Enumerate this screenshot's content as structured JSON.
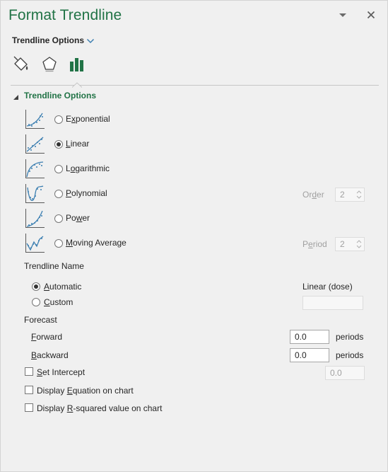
{
  "pane": {
    "title": "Format Trendline",
    "menu_icon": "dropdown-arrow-icon",
    "close_icon": "close-icon"
  },
  "options_menu": {
    "label": "Trendline Options"
  },
  "category_tabs": [
    {
      "name": "fill-line",
      "icon": "paint-bucket-icon"
    },
    {
      "name": "effects",
      "icon": "pentagon-icon"
    },
    {
      "name": "trendline-options",
      "icon": "bar-chart-icon",
      "selected": true
    }
  ],
  "section": {
    "title": "Trendline Options",
    "expanded": true
  },
  "types": [
    {
      "key": "exponential",
      "pre": "E",
      "mn": "x",
      "post": "ponential",
      "checked": false
    },
    {
      "key": "linear",
      "pre": "",
      "mn": "L",
      "post": "inear",
      "checked": true
    },
    {
      "key": "logarithmic",
      "pre": "L",
      "mn": "o",
      "post": "garithmic",
      "checked": false
    },
    {
      "key": "polynomial",
      "pre": "",
      "mn": "P",
      "post": "olynomial",
      "checked": false
    },
    {
      "key": "power",
      "pre": "Po",
      "mn": "w",
      "post": "er",
      "checked": false
    },
    {
      "key": "moving-average",
      "pre": "",
      "mn": "M",
      "post": "oving Average",
      "checked": false
    }
  ],
  "order": {
    "pre": "Or",
    "mn": "d",
    "post": "er",
    "value": "2"
  },
  "period": {
    "pre": "P",
    "mn": "e",
    "post": "riod",
    "value": "2"
  },
  "trendline_name": {
    "heading": "Trendline Name",
    "automatic": {
      "pre": "",
      "mn": "A",
      "post": "utomatic",
      "checked": true
    },
    "custom": {
      "pre": "",
      "mn": "C",
      "post": "ustom",
      "checked": false
    },
    "auto_value": "Linear (dose)",
    "custom_value": ""
  },
  "forecast": {
    "heading": "Forecast",
    "forward": {
      "pre": "",
      "mn": "F",
      "post": "orward",
      "value": "0.0",
      "unit": "periods"
    },
    "backward": {
      "pre": "",
      "mn": "B",
      "post": "ackward",
      "value": "0.0",
      "unit": "periods"
    }
  },
  "set_intercept": {
    "pre": "",
    "mn": "S",
    "post": "et Intercept",
    "checked": false,
    "value": "0.0"
  },
  "display_equation": {
    "pre": "Display ",
    "mn": "E",
    "post": "quation on chart",
    "checked": false
  },
  "display_rsquared": {
    "pre": "Display ",
    "mn": "R",
    "post": "-squared value on chart",
    "checked": false
  },
  "colors": {
    "accent": "#217346",
    "text": "#262626",
    "disabled": "#a0a0a0",
    "background": "#f0f0f0"
  }
}
